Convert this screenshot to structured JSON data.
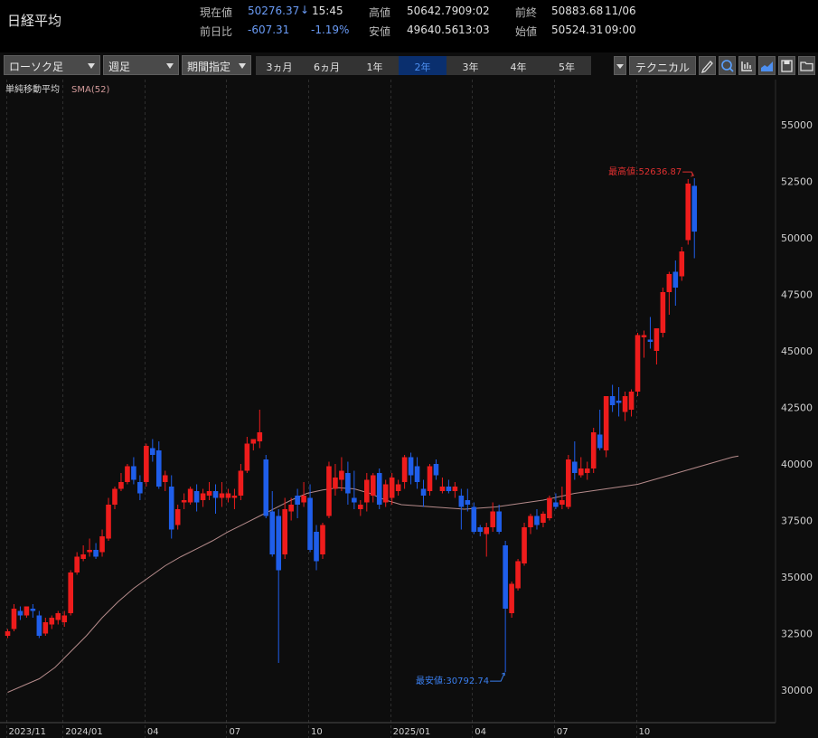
{
  "header": {
    "title": "日経平均",
    "current_label": "現在値",
    "current_value": "50276.37",
    "current_arrow": "↓",
    "current_time": "15:45",
    "change_label": "前日比",
    "change_value": "-607.31",
    "change_pct": "-1.19%",
    "high_label": "高値",
    "high_value": "50642.79",
    "high_time": "09:02",
    "low_label": "安値",
    "low_value": "49640.56",
    "low_time": "13:03",
    "prev_close_label": "前終",
    "prev_close_value": "50883.68",
    "prev_close_date": "11/06",
    "open_label": "始値",
    "open_value": "50524.31",
    "open_time": "09:00"
  },
  "toolbar": {
    "chart_type": "ローソク足",
    "interval": "週足",
    "range_mode": "期間指定",
    "periods": [
      "3ヵ月",
      "6ヵ月",
      "1年",
      "2年",
      "3年",
      "4年",
      "5年"
    ],
    "active_period": "2年",
    "technical_label": "テクニカル",
    "icons": [
      "dropdown-icon",
      "pencil-icon",
      "zoom-icon",
      "volume-bars-icon",
      "area-chart-icon",
      "save-icon",
      "folder-icon"
    ]
  },
  "colors": {
    "up": "#ee1c1c",
    "down": "#1f5eea",
    "sma": "#b48a8a",
    "background": "#0d0d0d"
  },
  "chart_data": {
    "type": "candlestick",
    "indicator_label": "単純移動平均",
    "indicator_param": "SMA(52)",
    "y_ticks": [
      30000,
      32500,
      35000,
      37500,
      40000,
      42500,
      45000,
      47500,
      50000,
      52500,
      55000
    ],
    "x_labels": [
      "2023/11",
      "2024/01",
      "04",
      "07",
      "10",
      "2025/01",
      "04",
      "07",
      "10"
    ],
    "x_label_weeks": [
      0,
      9,
      22,
      35,
      48,
      61,
      74,
      87,
      100
    ],
    "ylim": [
      29000,
      56000
    ],
    "max_annotation": "最高値:52636.87",
    "min_annotation": "最安値:30792.74",
    "candles": [
      {
        "o": 32400,
        "h": 32700,
        "l": 32300,
        "c": 32600
      },
      {
        "o": 32700,
        "h": 33800,
        "l": 32600,
        "c": 33600
      },
      {
        "o": 33500,
        "h": 33700,
        "l": 33100,
        "c": 33300
      },
      {
        "o": 33300,
        "h": 33700,
        "l": 33200,
        "c": 33700
      },
      {
        "o": 33600,
        "h": 33800,
        "l": 33200,
        "c": 33500
      },
      {
        "o": 33300,
        "h": 33500,
        "l": 32300,
        "c": 32400
      },
      {
        "o": 32500,
        "h": 33200,
        "l": 32400,
        "c": 33000
      },
      {
        "o": 32900,
        "h": 33300,
        "l": 32700,
        "c": 33200
      },
      {
        "o": 33100,
        "h": 33500,
        "l": 32900,
        "c": 33400
      },
      {
        "o": 33000,
        "h": 33500,
        "l": 32800,
        "c": 33300
      },
      {
        "o": 33400,
        "h": 35300,
        "l": 33300,
        "c": 35200
      },
      {
        "o": 35200,
        "h": 36100,
        "l": 35100,
        "c": 35900
      },
      {
        "o": 35800,
        "h": 36400,
        "l": 35700,
        "c": 36000
      },
      {
        "o": 36100,
        "h": 36700,
        "l": 35900,
        "c": 36200
      },
      {
        "o": 36200,
        "h": 36500,
        "l": 35800,
        "c": 35900
      },
      {
        "o": 36100,
        "h": 37100,
        "l": 35900,
        "c": 36800
      },
      {
        "o": 36700,
        "h": 38500,
        "l": 36600,
        "c": 38200
      },
      {
        "o": 38200,
        "h": 39000,
        "l": 38000,
        "c": 38900
      },
      {
        "o": 38900,
        "h": 39600,
        "l": 38800,
        "c": 39200
      },
      {
        "o": 39200,
        "h": 40000,
        "l": 39100,
        "c": 39900
      },
      {
        "o": 39900,
        "h": 40300,
        "l": 39100,
        "c": 39300
      },
      {
        "o": 39200,
        "h": 39500,
        "l": 38400,
        "c": 38700
      },
      {
        "o": 39200,
        "h": 40900,
        "l": 39000,
        "c": 40800
      },
      {
        "o": 40700,
        "h": 41100,
        "l": 40100,
        "c": 40400
      },
      {
        "o": 40600,
        "h": 41000,
        "l": 38900,
        "c": 39000
      },
      {
        "o": 39200,
        "h": 39700,
        "l": 38800,
        "c": 39500
      },
      {
        "o": 39000,
        "h": 39500,
        "l": 36700,
        "c": 37100
      },
      {
        "o": 37300,
        "h": 38200,
        "l": 37100,
        "c": 38000
      },
      {
        "o": 38300,
        "h": 38700,
        "l": 38000,
        "c": 38400
      },
      {
        "o": 38300,
        "h": 39000,
        "l": 38200,
        "c": 38900
      },
      {
        "o": 38800,
        "h": 39100,
        "l": 37900,
        "c": 38300
      },
      {
        "o": 38400,
        "h": 38900,
        "l": 38100,
        "c": 38700
      },
      {
        "o": 38600,
        "h": 39200,
        "l": 38400,
        "c": 38800
      },
      {
        "o": 38800,
        "h": 39100,
        "l": 37800,
        "c": 38500
      },
      {
        "o": 38500,
        "h": 39200,
        "l": 38100,
        "c": 38700
      },
      {
        "o": 38500,
        "h": 38900,
        "l": 38300,
        "c": 38700
      },
      {
        "o": 38500,
        "h": 38900,
        "l": 38000,
        "c": 38600
      },
      {
        "o": 38600,
        "h": 40000,
        "l": 38400,
        "c": 39700
      },
      {
        "o": 39700,
        "h": 41200,
        "l": 39600,
        "c": 40900
      },
      {
        "o": 40900,
        "h": 41100,
        "l": 40600,
        "c": 41100
      },
      {
        "o": 41000,
        "h": 42400,
        "l": 40700,
        "c": 41400
      },
      {
        "o": 40200,
        "h": 40400,
        "l": 37600,
        "c": 37700
      },
      {
        "o": 37900,
        "h": 38800,
        "l": 35900,
        "c": 36000
      },
      {
        "o": 37700,
        "h": 38000,
        "l": 31200,
        "c": 35300
      },
      {
        "o": 36000,
        "h": 38500,
        "l": 35800,
        "c": 38000
      },
      {
        "o": 37900,
        "h": 38500,
        "l": 37500,
        "c": 38200
      },
      {
        "o": 38600,
        "h": 38900,
        "l": 37600,
        "c": 38200
      },
      {
        "o": 38300,
        "h": 39200,
        "l": 38100,
        "c": 38600
      },
      {
        "o": 38500,
        "h": 39100,
        "l": 36100,
        "c": 36200
      },
      {
        "o": 37000,
        "h": 37300,
        "l": 35300,
        "c": 35700
      },
      {
        "o": 36000,
        "h": 37400,
        "l": 35800,
        "c": 37300
      },
      {
        "o": 37700,
        "h": 40100,
        "l": 37600,
        "c": 39900
      },
      {
        "o": 38900,
        "h": 40000,
        "l": 38600,
        "c": 39400
      },
      {
        "o": 39300,
        "h": 40300,
        "l": 38800,
        "c": 39700
      },
      {
        "o": 39600,
        "h": 40100,
        "l": 38200,
        "c": 38700
      },
      {
        "o": 38500,
        "h": 39700,
        "l": 38000,
        "c": 38300
      },
      {
        "o": 38000,
        "h": 38400,
        "l": 37700,
        "c": 38200
      },
      {
        "o": 38300,
        "h": 39600,
        "l": 37900,
        "c": 39300
      },
      {
        "o": 38600,
        "h": 39600,
        "l": 38300,
        "c": 39500
      },
      {
        "o": 39600,
        "h": 39800,
        "l": 38000,
        "c": 38200
      },
      {
        "o": 38300,
        "h": 39300,
        "l": 38100,
        "c": 39100
      },
      {
        "o": 38500,
        "h": 39600,
        "l": 38200,
        "c": 39400
      },
      {
        "o": 38800,
        "h": 39300,
        "l": 38600,
        "c": 39100
      },
      {
        "o": 39200,
        "h": 40400,
        "l": 38900,
        "c": 40300
      },
      {
        "o": 40300,
        "h": 40500,
        "l": 39100,
        "c": 39500
      },
      {
        "o": 39900,
        "h": 40300,
        "l": 38900,
        "c": 39200
      },
      {
        "o": 38900,
        "h": 39300,
        "l": 38100,
        "c": 38600
      },
      {
        "o": 38800,
        "h": 40000,
        "l": 38600,
        "c": 39900
      },
      {
        "o": 40000,
        "h": 40200,
        "l": 39300,
        "c": 39500
      },
      {
        "o": 38800,
        "h": 39400,
        "l": 38700,
        "c": 39000
      },
      {
        "o": 39000,
        "h": 39300,
        "l": 38700,
        "c": 38800
      },
      {
        "o": 38800,
        "h": 39200,
        "l": 38500,
        "c": 39000
      },
      {
        "o": 38600,
        "h": 38900,
        "l": 37100,
        "c": 38100
      },
      {
        "o": 38400,
        "h": 38900,
        "l": 37900,
        "c": 38200
      },
      {
        "o": 38100,
        "h": 38300,
        "l": 36900,
        "c": 37000
      },
      {
        "o": 37200,
        "h": 37300,
        "l": 36800,
        "c": 37000
      },
      {
        "o": 36900,
        "h": 37400,
        "l": 35900,
        "c": 37200
      },
      {
        "o": 37200,
        "h": 38300,
        "l": 37000,
        "c": 37900
      },
      {
        "o": 37900,
        "h": 38200,
        "l": 36900,
        "c": 37000
      },
      {
        "o": 36400,
        "h": 36600,
        "l": 30792.74,
        "c": 33600
      },
      {
        "o": 33400,
        "h": 34800,
        "l": 33200,
        "c": 34700
      },
      {
        "o": 34500,
        "h": 35800,
        "l": 34400,
        "c": 35700
      },
      {
        "o": 35600,
        "h": 37400,
        "l": 35500,
        "c": 37200
      },
      {
        "o": 37200,
        "h": 37800,
        "l": 36900,
        "c": 37700
      },
      {
        "o": 37700,
        "h": 38000,
        "l": 37100,
        "c": 37300
      },
      {
        "o": 37400,
        "h": 37900,
        "l": 37200,
        "c": 37800
      },
      {
        "o": 37600,
        "h": 38600,
        "l": 37500,
        "c": 38500
      },
      {
        "o": 38300,
        "h": 38700,
        "l": 38000,
        "c": 38100
      },
      {
        "o": 38200,
        "h": 39000,
        "l": 38000,
        "c": 38400
      },
      {
        "o": 38100,
        "h": 40400,
        "l": 38000,
        "c": 40200
      },
      {
        "o": 40100,
        "h": 41000,
        "l": 39300,
        "c": 39600
      },
      {
        "o": 39500,
        "h": 40300,
        "l": 39400,
        "c": 39800
      },
      {
        "o": 39600,
        "h": 40100,
        "l": 39300,
        "c": 39800
      },
      {
        "o": 39800,
        "h": 41600,
        "l": 39600,
        "c": 41400
      },
      {
        "o": 41300,
        "h": 42400,
        "l": 40600,
        "c": 40700
      },
      {
        "o": 40600,
        "h": 43000,
        "l": 40300,
        "c": 43000
      },
      {
        "o": 43000,
        "h": 43500,
        "l": 42300,
        "c": 42600
      },
      {
        "o": 42800,
        "h": 43400,
        "l": 42100,
        "c": 42700
      },
      {
        "o": 42300,
        "h": 43200,
        "l": 41900,
        "c": 43000
      },
      {
        "o": 42400,
        "h": 43300,
        "l": 42100,
        "c": 43200
      },
      {
        "o": 43200,
        "h": 45800,
        "l": 43000,
        "c": 45700
      },
      {
        "o": 45600,
        "h": 45900,
        "l": 44700,
        "c": 45700
      },
      {
        "o": 45500,
        "h": 46500,
        "l": 45100,
        "c": 45400
      },
      {
        "o": 45000,
        "h": 45800,
        "l": 44400,
        "c": 46000
      },
      {
        "o": 45800,
        "h": 47800,
        "l": 45600,
        "c": 47600
      },
      {
        "o": 47600,
        "h": 48500,
        "l": 46600,
        "c": 48400
      },
      {
        "o": 48500,
        "h": 49000,
        "l": 47000,
        "c": 47800
      },
      {
        "o": 48300,
        "h": 49600,
        "l": 48100,
        "c": 49400
      },
      {
        "o": 49900,
        "h": 52600,
        "l": 49700,
        "c": 52400
      },
      {
        "o": 52300,
        "h": 52636.87,
        "l": 49100,
        "c": 50276
      }
    ],
    "sma52": [
      [
        0,
        29900
      ],
      [
        5,
        30200
      ],
      [
        10,
        30500
      ],
      [
        15,
        31000
      ],
      [
        20,
        31700
      ],
      [
        25,
        32400
      ],
      [
        30,
        33200
      ],
      [
        35,
        33900
      ],
      [
        40,
        34500
      ],
      [
        45,
        35000
      ],
      [
        50,
        35500
      ],
      [
        55,
        35900
      ],
      [
        60,
        36250
      ],
      [
        65,
        36600
      ],
      [
        70,
        37000
      ],
      [
        75,
        37350
      ],
      [
        80,
        37700
      ],
      [
        85,
        38050
      ],
      [
        90,
        38400
      ],
      [
        95,
        38700
      ],
      [
        100,
        38850
      ],
      [
        105,
        38950
      ],
      [
        110,
        38900
      ],
      [
        115,
        38700
      ],
      [
        120,
        38400
      ],
      [
        125,
        38200
      ],
      [
        130,
        38150
      ],
      [
        135,
        38100
      ],
      [
        140,
        38050
      ],
      [
        145,
        38000
      ],
      [
        150,
        38050
      ],
      [
        155,
        38100
      ],
      [
        160,
        38200
      ],
      [
        165,
        38300
      ],
      [
        170,
        38400
      ],
      [
        175,
        38550
      ],
      [
        180,
        38700
      ],
      [
        185,
        38800
      ],
      [
        190,
        38900
      ],
      [
        195,
        39000
      ],
      [
        200,
        39100
      ],
      [
        205,
        39300
      ],
      [
        210,
        39500
      ],
      [
        215,
        39700
      ],
      [
        220,
        39900
      ],
      [
        225,
        40100
      ],
      [
        230,
        40300
      ],
      [
        232,
        40350
      ]
    ]
  }
}
